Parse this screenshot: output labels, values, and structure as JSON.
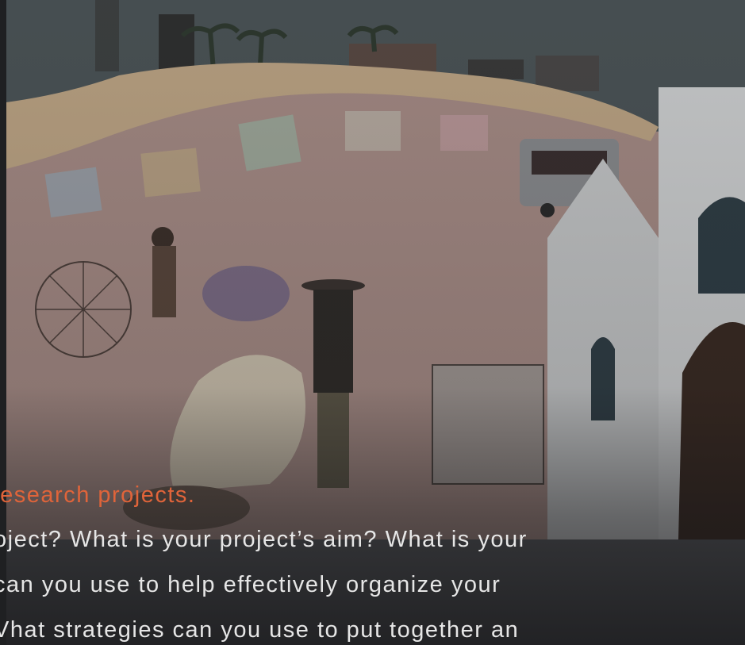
{
  "hero": {
    "heading": "research projects.",
    "body_lines": [
      "oject? What is your project’s aim? What is your",
      "can you use to help effectively organize your",
      "Vhat strategies can you use to put together an"
    ]
  },
  "colors": {
    "accent": "#e0643a",
    "text": "#e6e6e6",
    "sky": "#4a5356",
    "wall": "#b49a94",
    "church": "#c9cbcc"
  }
}
